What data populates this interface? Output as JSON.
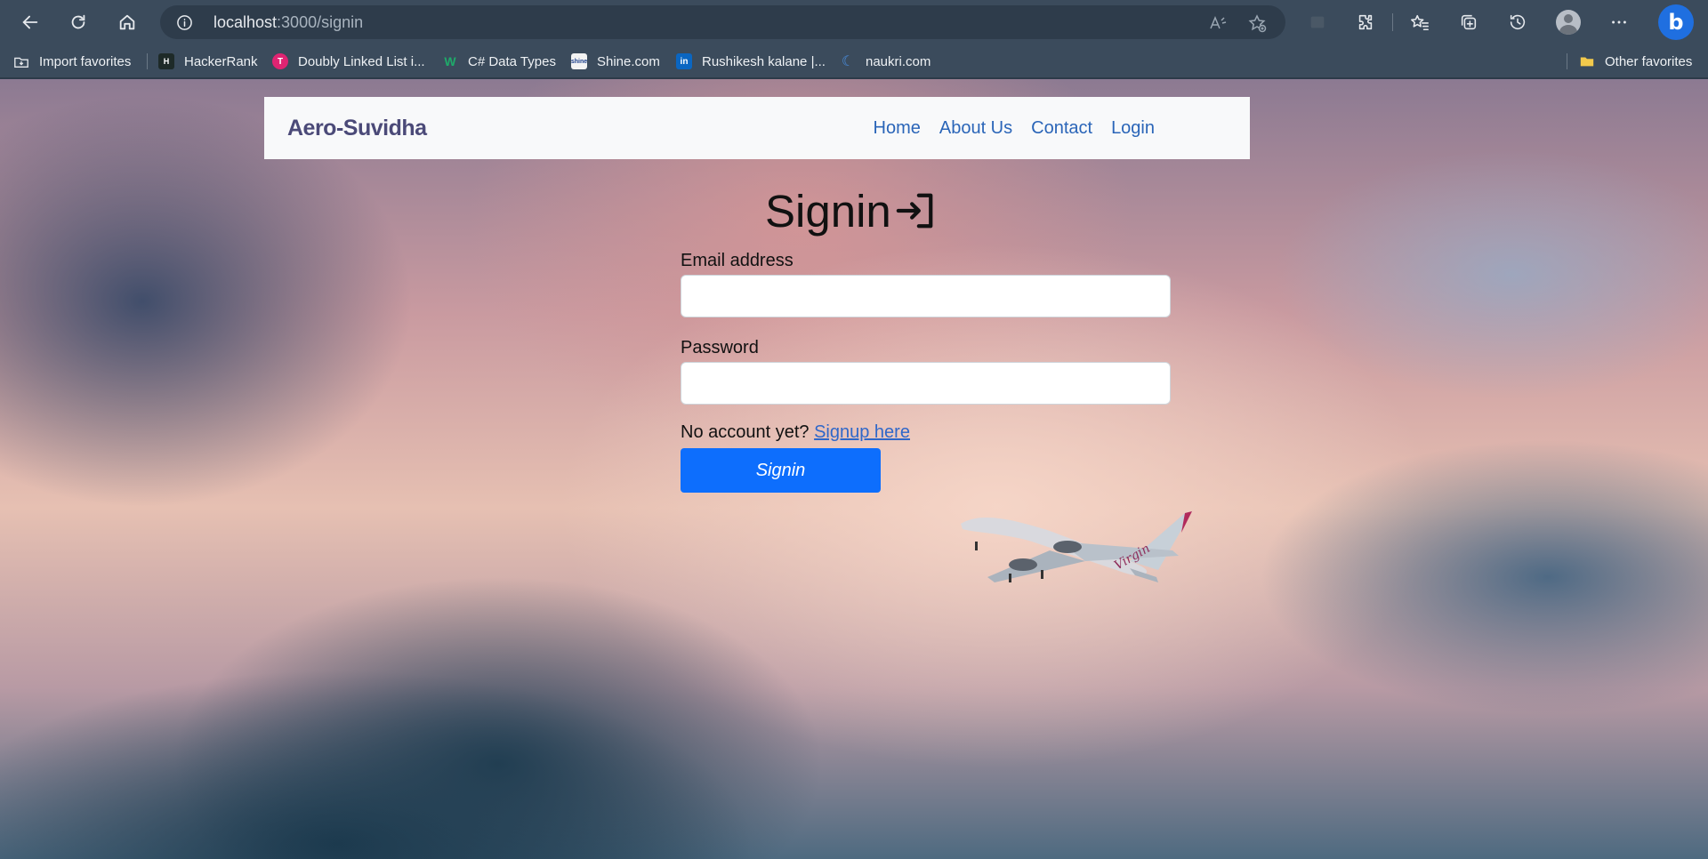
{
  "browser": {
    "url_host": "localhost",
    "url_path": ":3000/signin",
    "bookmarks": [
      {
        "label": "Import favorites",
        "icon": "import-icon"
      },
      {
        "label": "HackerRank",
        "icon": "hackerrank-icon"
      },
      {
        "label": "Doubly Linked List i...",
        "icon": "favicon-t-icon"
      },
      {
        "label": "C# Data Types",
        "icon": "favicon-w-icon"
      },
      {
        "label": "Shine.com",
        "icon": "shine-icon"
      },
      {
        "label": "Rushikesh kalane |...",
        "icon": "linkedin-icon"
      },
      {
        "label": "naukri.com",
        "icon": "naukri-icon"
      }
    ],
    "other_favorites": "Other favorites"
  },
  "navbar": {
    "brand": "Aero-Suvidha",
    "links": [
      "Home",
      "About Us",
      "Contact",
      "Login"
    ]
  },
  "form": {
    "title": "Signin",
    "email_label": "Email address",
    "email_value": "",
    "password_label": "Password",
    "password_value": "",
    "no_account_text": "No account yet?",
    "signup_link": "Signup here",
    "submit_label": "Signin"
  },
  "colors": {
    "primary": "#0d6efd",
    "nav_link": "#2a65b8",
    "brand": "#4b4a78"
  }
}
